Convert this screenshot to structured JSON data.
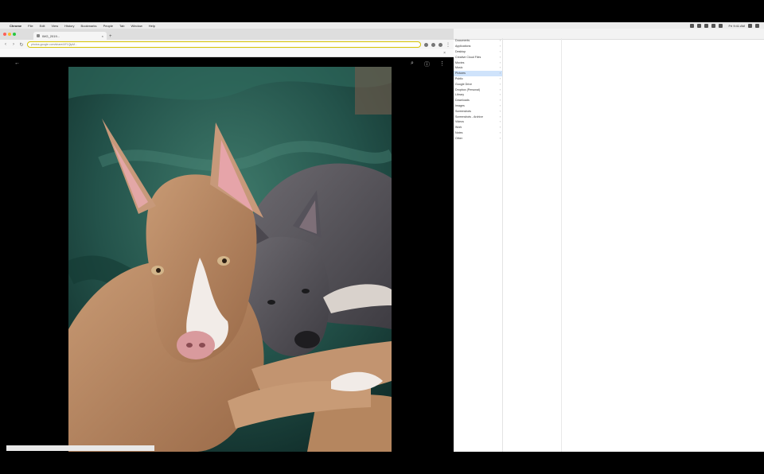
{
  "menubar": {
    "app_name": "Chrome",
    "items": [
      "File",
      "Edit",
      "View",
      "History",
      "Bookmarks",
      "People",
      "Tab",
      "Window",
      "Help"
    ],
    "clock": "Fri 9:41 AM"
  },
  "browser": {
    "tab_title": "IMG_2019...",
    "url": "photos.google.com/share/AF1QipM...",
    "infobar_text": "",
    "statusbar_text": ""
  },
  "devtools": {
    "header_title": "",
    "files": [
      {
        "label": "Documents",
        "arrow": "›"
      },
      {
        "label": "Applications",
        "arrow": "›"
      },
      {
        "label": "Desktop",
        "arrow": "›"
      },
      {
        "label": "Creative Cloud Files",
        "arrow": "›"
      },
      {
        "label": "Movies",
        "arrow": "›"
      },
      {
        "label": "Music",
        "arrow": "›"
      },
      {
        "label": "Pictures",
        "arrow": "›",
        "selected": true
      },
      {
        "label": "Public",
        "arrow": "›"
      },
      {
        "label": "Google Drive",
        "arrow": "›"
      },
      {
        "label": "Dropbox (Personal)",
        "arrow": "›"
      },
      {
        "label": "Library",
        "arrow": "›"
      },
      {
        "label": "Downloads",
        "arrow": "›"
      },
      {
        "label": "Images",
        "arrow": "›"
      },
      {
        "label": "Screenshots",
        "arrow": "›"
      },
      {
        "label": "Screenshots - Archive",
        "arrow": "›"
      },
      {
        "label": "Videos",
        "arrow": "›"
      },
      {
        "label": "Work",
        "arrow": "›"
      },
      {
        "label": "Notes",
        "arrow": "›"
      },
      {
        "label": "Other",
        "arrow": "›"
      }
    ]
  },
  "colors": {
    "omnibox_border": "#d6c400",
    "selected_row": "#cfe3fb"
  },
  "icons": {
    "back": "arrow-left-icon",
    "zoom": "zoom-icon",
    "info": "info-icon",
    "more": "more-vert-icon"
  }
}
